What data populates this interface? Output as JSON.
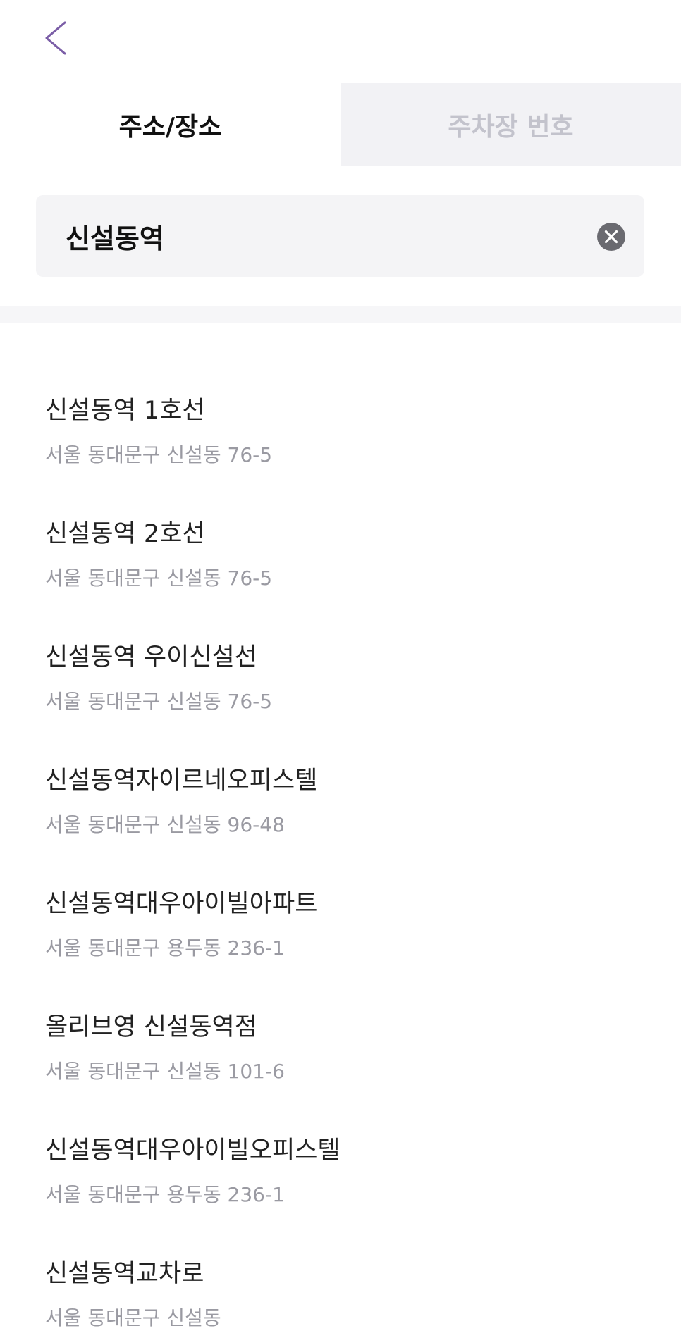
{
  "tabs": [
    {
      "label": "주소/장소",
      "active": true
    },
    {
      "label": "주차장 번호",
      "active": false
    }
  ],
  "search": {
    "value": "신설동역"
  },
  "results": [
    {
      "name": "신설동역 1호선",
      "address": "서울 동대문구 신설동 76-5"
    },
    {
      "name": "신설동역 2호선",
      "address": "서울 동대문구 신설동 76-5"
    },
    {
      "name": "신설동역 우이신설선",
      "address": "서울 동대문구 신설동 76-5"
    },
    {
      "name": "신설동역자이르네오피스텔",
      "address": "서울 동대문구 신설동 96-48"
    },
    {
      "name": "신설동역대우아이빌아파트",
      "address": "서울 동대문구 용두동 236-1"
    },
    {
      "name": "올리브영 신설동역점",
      "address": "서울 동대문구 신설동 101-6"
    },
    {
      "name": "신설동역대우아이빌오피스텔",
      "address": "서울 동대문구 용두동 236-1"
    },
    {
      "name": "신설동역교차로",
      "address": "서울 동대문구 신설동"
    }
  ],
  "icons": {
    "back": "chevron-left-icon",
    "clear": "clear-circle-icon"
  },
  "colors": {
    "accent": "#7b5ea7",
    "inactive_tab_bg": "#f2f2f5",
    "inactive_tab_text": "#c3c3cc",
    "address_text": "#9a9aa2"
  }
}
